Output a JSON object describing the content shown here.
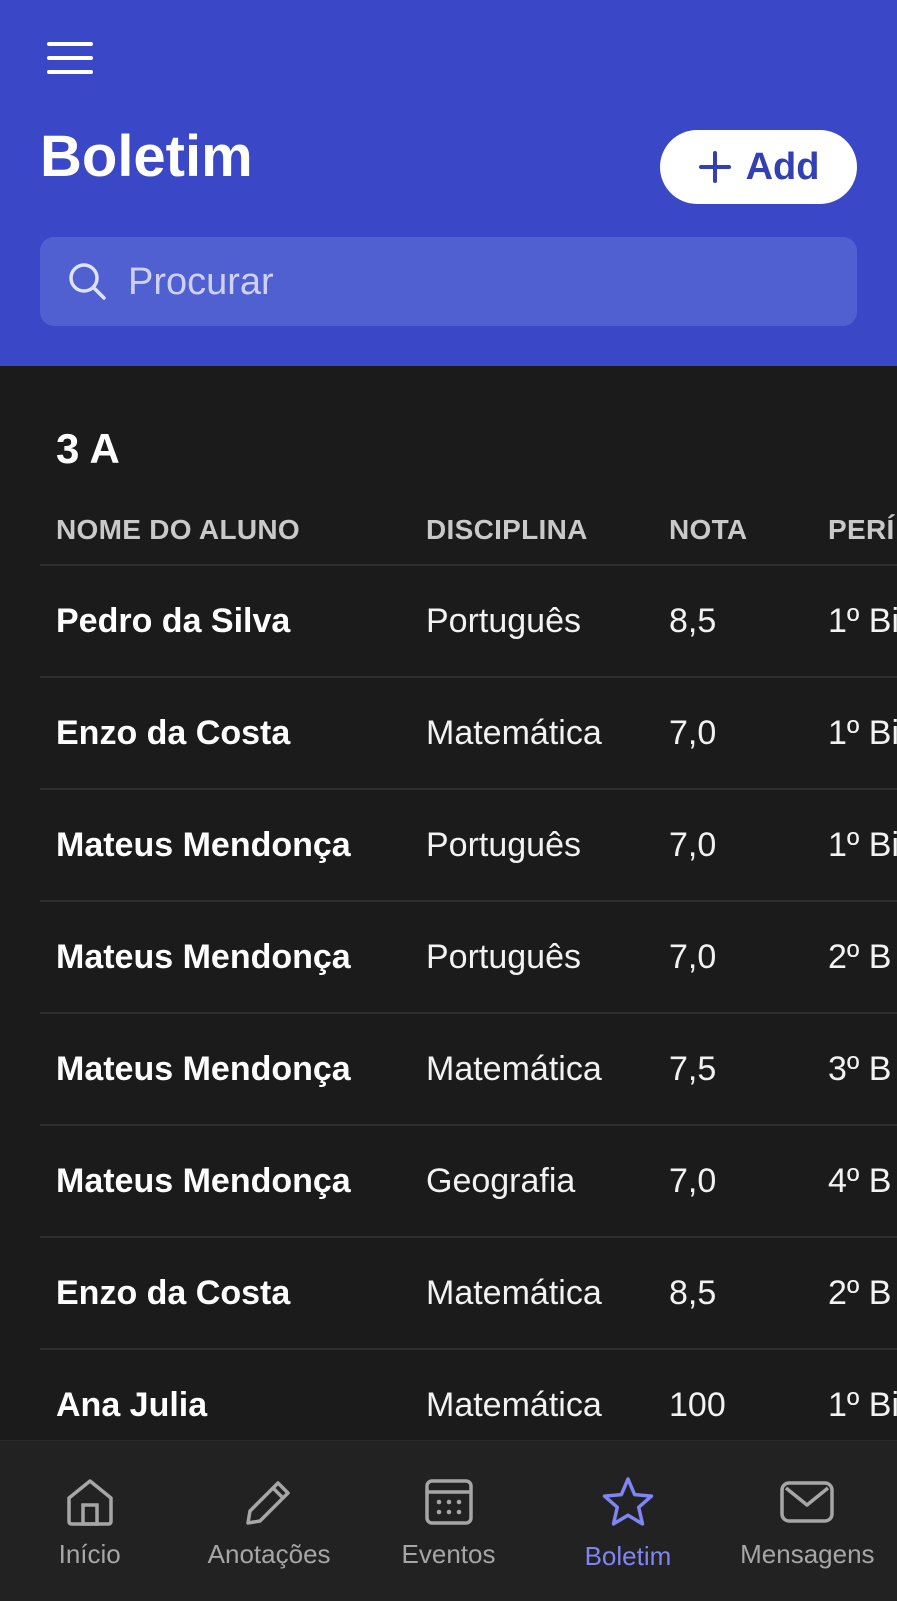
{
  "header": {
    "title": "Boletim",
    "add_label": "Add",
    "search_placeholder": "Procurar"
  },
  "group": {
    "title": "3 A"
  },
  "table": {
    "columns": [
      "NOME DO ALUNO",
      "DISCIPLINA",
      "NOTA",
      "PERÍ"
    ],
    "rows": [
      {
        "name": "Pedro da Silva",
        "subject": "Português",
        "grade": "8,5",
        "period": "1º Bi"
      },
      {
        "name": "Enzo da Costa",
        "subject": "Matemática",
        "grade": "7,0",
        "period": "1º Bi"
      },
      {
        "name": "Mateus Mendonça",
        "subject": "Português",
        "grade": "7,0",
        "period": "1º Bi"
      },
      {
        "name": "Mateus Mendonça",
        "subject": "Português",
        "grade": "7,0",
        "period": "2º B"
      },
      {
        "name": "Mateus Mendonça",
        "subject": "Matemática",
        "grade": "7,5",
        "period": "3º B"
      },
      {
        "name": "Mateus Mendonça",
        "subject": "Geografia",
        "grade": "7,0",
        "period": "4º B"
      },
      {
        "name": "Enzo da Costa",
        "subject": "Matemática",
        "grade": "8,5",
        "period": "2º B"
      },
      {
        "name": "Ana Julia",
        "subject": "Matemática",
        "grade": "100",
        "period": "1º Bi"
      }
    ]
  },
  "nav": {
    "items": [
      {
        "label": "Início",
        "icon": "home-icon"
      },
      {
        "label": "Anotações",
        "icon": "pencil-icon"
      },
      {
        "label": "Eventos",
        "icon": "calendar-icon"
      },
      {
        "label": "Boletim",
        "icon": "star-icon",
        "active": true
      },
      {
        "label": "Mensagens",
        "icon": "mail-icon"
      }
    ]
  },
  "colors": {
    "header_bg": "#3a47c6",
    "search_bg": "#5160d1",
    "page_bg": "#1b1b1b",
    "nav_active": "#7f85f2"
  }
}
